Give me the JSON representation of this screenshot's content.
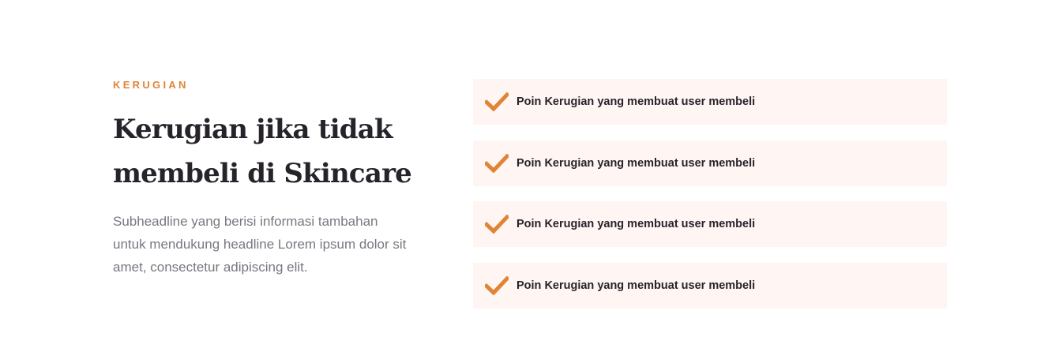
{
  "section": {
    "eyebrow": "KERUGIAN",
    "headline": "Kerugian jika tidak membeli di Skincare",
    "subheadline": "Subheadline yang berisi informasi tambahan untuk mendukung headline Lorem ipsum dolor sit amet, consectetur adipiscing elit."
  },
  "points": [
    {
      "icon": "check-icon",
      "label": "Poin Kerugian yang membuat user membeli"
    },
    {
      "icon": "check-icon",
      "label": "Poin Kerugian yang membuat user membeli"
    },
    {
      "icon": "check-icon",
      "label": "Poin Kerugian yang membuat user membeli"
    },
    {
      "icon": "check-icon",
      "label": "Poin Kerugian yang membuat user membeli"
    }
  ],
  "colors": {
    "accent": "#e08436",
    "heading": "#27232b",
    "body_text": "#7b7680",
    "card_background": "#fff6f4"
  }
}
